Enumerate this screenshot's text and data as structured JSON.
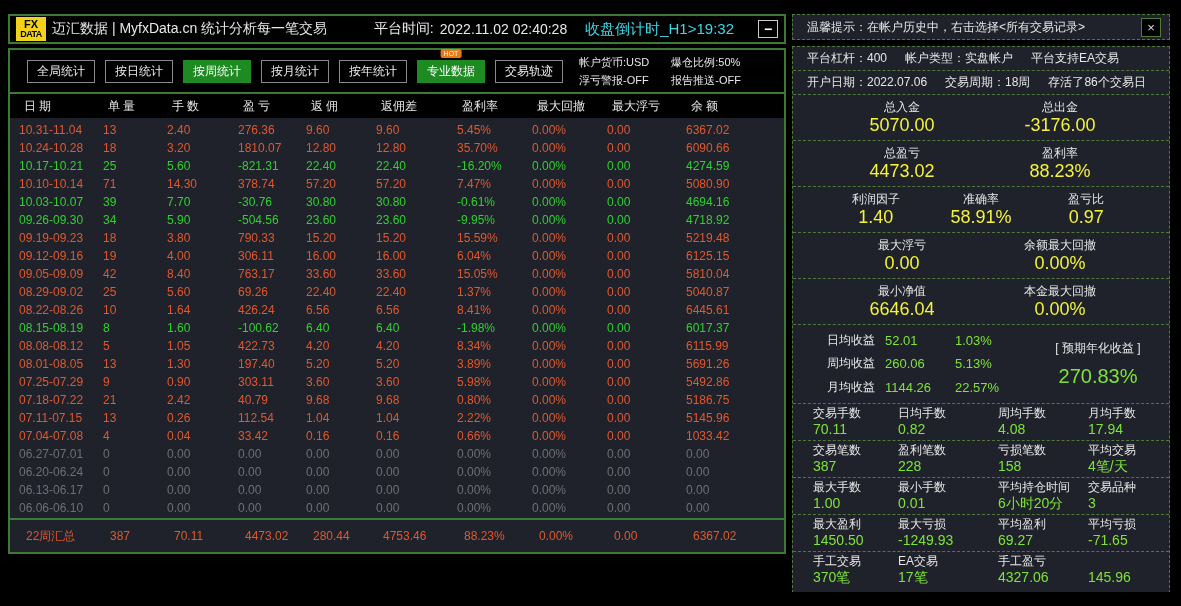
{
  "header": {
    "logo": {
      "top": "FX",
      "bottom": "DATA"
    },
    "title": "迈汇数据 | MyfxData.cn  统计分析每一笔交易",
    "time_label": "平台时间:",
    "time": "2022.11.02 02:40:28",
    "countdown": "收盘倒计时_H1>19:32",
    "minimize": "−"
  },
  "toolbar": {
    "buttons": [
      {
        "label": "全局统计",
        "selected": false
      },
      {
        "label": "按日统计",
        "selected": false
      },
      {
        "label": "按周统计",
        "selected": true
      },
      {
        "label": "按月统计",
        "selected": false
      },
      {
        "label": "按年统计",
        "selected": false
      },
      {
        "label": "专业数据",
        "selected": true,
        "badge": "HOT"
      },
      {
        "label": "交易轨迹",
        "selected": false
      }
    ],
    "info": [
      "帐户货币:USD",
      "爆仓比例:50%",
      "浮亏警报-OFF",
      "报告推送-OFF"
    ]
  },
  "table": {
    "columns": [
      "日 期",
      "单 量",
      "手 数",
      "盈 亏",
      "返 佣",
      "返佣差",
      "盈利率",
      "最大回撤",
      "最大浮亏",
      "余 额"
    ],
    "rows": [
      {
        "kind": "gain",
        "cells": [
          "10.31-11.04",
          "13",
          "2.40",
          "276.36",
          "9.60",
          "9.60",
          "5.45%",
          "0.00%",
          "0.00",
          "6367.02"
        ]
      },
      {
        "kind": "gain",
        "cells": [
          "10.24-10.28",
          "18",
          "3.20",
          "1810.07",
          "12.80",
          "12.80",
          "35.70%",
          "0.00%",
          "0.00",
          "6090.66"
        ]
      },
      {
        "kind": "loss",
        "cells": [
          "10.17-10.21",
          "25",
          "5.60",
          "-821.31",
          "22.40",
          "22.40",
          "-16.20%",
          "0.00%",
          "0.00",
          "4274.59"
        ]
      },
      {
        "kind": "gain",
        "cells": [
          "10.10-10.14",
          "71",
          "14.30",
          "378.74",
          "57.20",
          "57.20",
          "7.47%",
          "0.00%",
          "0.00",
          "5080.90"
        ]
      },
      {
        "kind": "loss",
        "cells": [
          "10.03-10.07",
          "39",
          "7.70",
          "-30.76",
          "30.80",
          "30.80",
          "-0.61%",
          "0.00%",
          "0.00",
          "4694.16"
        ]
      },
      {
        "kind": "loss",
        "cells": [
          "09.26-09.30",
          "34",
          "5.90",
          "-504.56",
          "23.60",
          "23.60",
          "-9.95%",
          "0.00%",
          "0.00",
          "4718.92"
        ]
      },
      {
        "kind": "gain",
        "cells": [
          "09.19-09.23",
          "18",
          "3.80",
          "790.33",
          "15.20",
          "15.20",
          "15.59%",
          "0.00%",
          "0.00",
          "5219.48"
        ]
      },
      {
        "kind": "gain",
        "cells": [
          "09.12-09.16",
          "19",
          "4.00",
          "306.11",
          "16.00",
          "16.00",
          "6.04%",
          "0.00%",
          "0.00",
          "6125.15"
        ]
      },
      {
        "kind": "gain",
        "cells": [
          "09.05-09.09",
          "42",
          "8.40",
          "763.17",
          "33.60",
          "33.60",
          "15.05%",
          "0.00%",
          "0.00",
          "5810.04"
        ]
      },
      {
        "kind": "gain",
        "cells": [
          "08.29-09.02",
          "25",
          "5.60",
          "69.26",
          "22.40",
          "22.40",
          "1.37%",
          "0.00%",
          "0.00",
          "5040.87"
        ]
      },
      {
        "kind": "gain",
        "cells": [
          "08.22-08.26",
          "10",
          "1.64",
          "426.24",
          "6.56",
          "6.56",
          "8.41%",
          "0.00%",
          "0.00",
          "6445.61"
        ]
      },
      {
        "kind": "loss",
        "cells": [
          "08.15-08.19",
          "8",
          "1.60",
          "-100.62",
          "6.40",
          "6.40",
          "-1.98%",
          "0.00%",
          "0.00",
          "6017.37"
        ]
      },
      {
        "kind": "gain",
        "cells": [
          "08.08-08.12",
          "5",
          "1.05",
          "422.73",
          "4.20",
          "4.20",
          "8.34%",
          "0.00%",
          "0.00",
          "6115.99"
        ]
      },
      {
        "kind": "gain",
        "cells": [
          "08.01-08.05",
          "13",
          "1.30",
          "197.40",
          "5.20",
          "5.20",
          "3.89%",
          "0.00%",
          "0.00",
          "5691.26"
        ]
      },
      {
        "kind": "gain",
        "cells": [
          "07.25-07.29",
          "9",
          "0.90",
          "303.11",
          "3.60",
          "3.60",
          "5.98%",
          "0.00%",
          "0.00",
          "5492.86"
        ]
      },
      {
        "kind": "gain",
        "cells": [
          "07.18-07.22",
          "21",
          "2.42",
          "40.79",
          "9.68",
          "9.68",
          "0.80%",
          "0.00%",
          "0.00",
          "5186.75"
        ]
      },
      {
        "kind": "gain",
        "cells": [
          "07.11-07.15",
          "13",
          "0.26",
          "112.54",
          "1.04",
          "1.04",
          "2.22%",
          "0.00%",
          "0.00",
          "5145.96"
        ]
      },
      {
        "kind": "gain",
        "cells": [
          "07.04-07.08",
          "4",
          "0.04",
          "33.42",
          "0.16",
          "0.16",
          "0.66%",
          "0.00%",
          "0.00",
          "1033.42"
        ]
      },
      {
        "kind": "zero",
        "cells": [
          "06.27-07.01",
          "0",
          "0.00",
          "0.00",
          "0.00",
          "0.00",
          "0.00%",
          "0.00%",
          "0.00",
          "0.00"
        ]
      },
      {
        "kind": "zero",
        "cells": [
          "06.20-06.24",
          "0",
          "0.00",
          "0.00",
          "0.00",
          "0.00",
          "0.00%",
          "0.00%",
          "0.00",
          "0.00"
        ]
      },
      {
        "kind": "zero",
        "cells": [
          "06.13-06.17",
          "0",
          "0.00",
          "0.00",
          "0.00",
          "0.00",
          "0.00%",
          "0.00%",
          "0.00",
          "0.00"
        ]
      },
      {
        "kind": "zero",
        "cells": [
          "06.06-06.10",
          "0",
          "0.00",
          "0.00",
          "0.00",
          "0.00",
          "0.00%",
          "0.00%",
          "0.00",
          "0.00"
        ]
      }
    ],
    "summary": [
      "22周汇总",
      "387",
      "70.11",
      "4473.02",
      "280.44",
      "4753.46",
      "88.23%",
      "0.00%",
      "0.00",
      "6367.02"
    ]
  },
  "side": {
    "tip": "温馨提示：在帐户历史中，右击选择<所有交易记录>",
    "close": "×",
    "info_lines": [
      [
        "平台杠杆：400",
        "帐户类型：实盘帐户",
        "平台支持EA交易"
      ],
      [
        "开户日期：2022.07.06",
        "交易周期：18周",
        "存活了86个交易日"
      ]
    ],
    "stats": [
      [
        {
          "label": "总入金",
          "value": "5070.00"
        },
        {
          "label": "总出金",
          "value": "-3176.00"
        }
      ],
      [
        {
          "label": "总盈亏",
          "value": "4473.02"
        },
        {
          "label": "盈利率",
          "value": "88.23%"
        }
      ],
      [
        {
          "label": "利润因子",
          "value": "1.40"
        },
        {
          "label": "准确率",
          "value": "58.91%"
        },
        {
          "label": "盈亏比",
          "value": "0.97"
        }
      ],
      [
        {
          "label": "最大浮亏",
          "value": "0.00"
        },
        {
          "label": "余额最大回撤",
          "value": "0.00%"
        }
      ],
      [
        {
          "label": "最小净值",
          "value": "6646.04"
        },
        {
          "label": "本金最大回撤",
          "value": "0.00%"
        }
      ]
    ],
    "returns": {
      "rows": [
        {
          "label": "日均收益",
          "value": "52.01",
          "pct": "1.03%"
        },
        {
          "label": "周均收益",
          "value": "260.06",
          "pct": "5.13%"
        },
        {
          "label": "月均收益",
          "value": "1144.26",
          "pct": "22.57%"
        }
      ],
      "annual_label": "[ 预期年化收益 ]",
      "annual_value": "270.83%"
    },
    "grids": [
      [
        {
          "label": "交易手数",
          "value": "70.11"
        },
        {
          "label": "日均手数",
          "value": "0.82"
        },
        {
          "label": "周均手数",
          "value": "4.08"
        },
        {
          "label": "月均手数",
          "value": "17.94"
        }
      ],
      [
        {
          "label": "交易笔数",
          "value": "387"
        },
        {
          "label": "盈利笔数",
          "value": "228"
        },
        {
          "label": "亏损笔数",
          "value": "158"
        },
        {
          "label": "平均交易",
          "value": "4笔/天"
        }
      ],
      [
        {
          "label": "最大手数",
          "value": "1.00"
        },
        {
          "label": "最小手数",
          "value": "0.01"
        },
        {
          "label": "平均持仓时间",
          "value": "6小时20分"
        },
        {
          "label": "交易品种",
          "value": "3"
        }
      ],
      [
        {
          "label": "最大盈利",
          "value": "1450.50"
        },
        {
          "label": "最大亏损",
          "value": "-1249.93"
        },
        {
          "label": "平均盈利",
          "value": "69.27"
        },
        {
          "label": "平均亏损",
          "value": "-71.65"
        }
      ],
      [
        {
          "label": "手工交易",
          "value": "370笔"
        },
        {
          "label": "EA交易",
          "value": "17笔"
        },
        {
          "label": "手工盈亏",
          "value": "4327.06"
        },
        {
          "value": "145.96"
        }
      ]
    ]
  }
}
